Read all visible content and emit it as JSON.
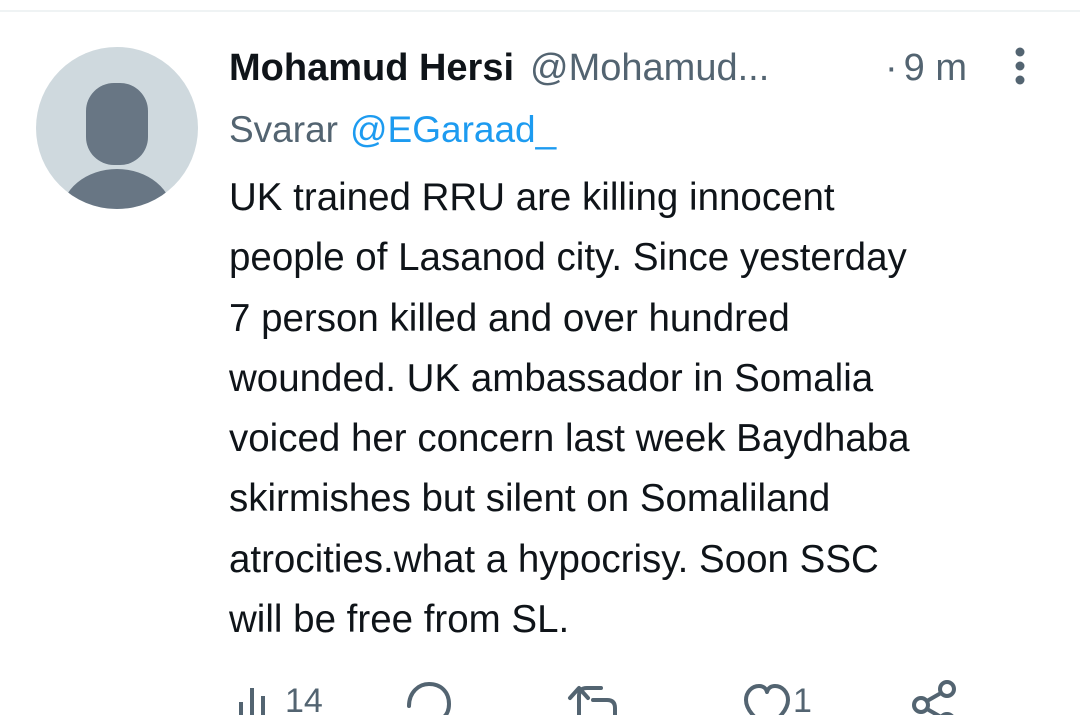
{
  "tweet": {
    "author": {
      "display_name": "Mohamud Hersi",
      "handle": "@Mohamud..."
    },
    "separator": "·",
    "time": "9 m",
    "reply": {
      "prefix": "Svarar",
      "mention": "@EGaraad_"
    },
    "text_lines": [
      "UK trained RRU are killing innocent",
      "people of Lasanod city. Since yesterday",
      "7 person killed and over hundred",
      "wounded. UK ambassador in Somalia",
      "voiced her concern last week Baydhaba",
      "skirmishes but silent on Somaliland",
      "atrocities.what a hypocrisy. Soon SSC",
      "will be free from SL."
    ],
    "actions": {
      "views": {
        "icon": "bar-chart-icon",
        "count": "14"
      },
      "reply": {
        "icon": "comment-icon"
      },
      "retweet": {
        "icon": "retweet-icon"
      },
      "like": {
        "icon": "heart-icon",
        "count": "1"
      },
      "share": {
        "icon": "share-icon"
      }
    }
  },
  "colors": {
    "text_primary": "#0f1419",
    "text_secondary": "#536471",
    "link": "#1d9bf0",
    "avatar_bg": "#cfd9de",
    "avatar_figure": "#687684"
  }
}
